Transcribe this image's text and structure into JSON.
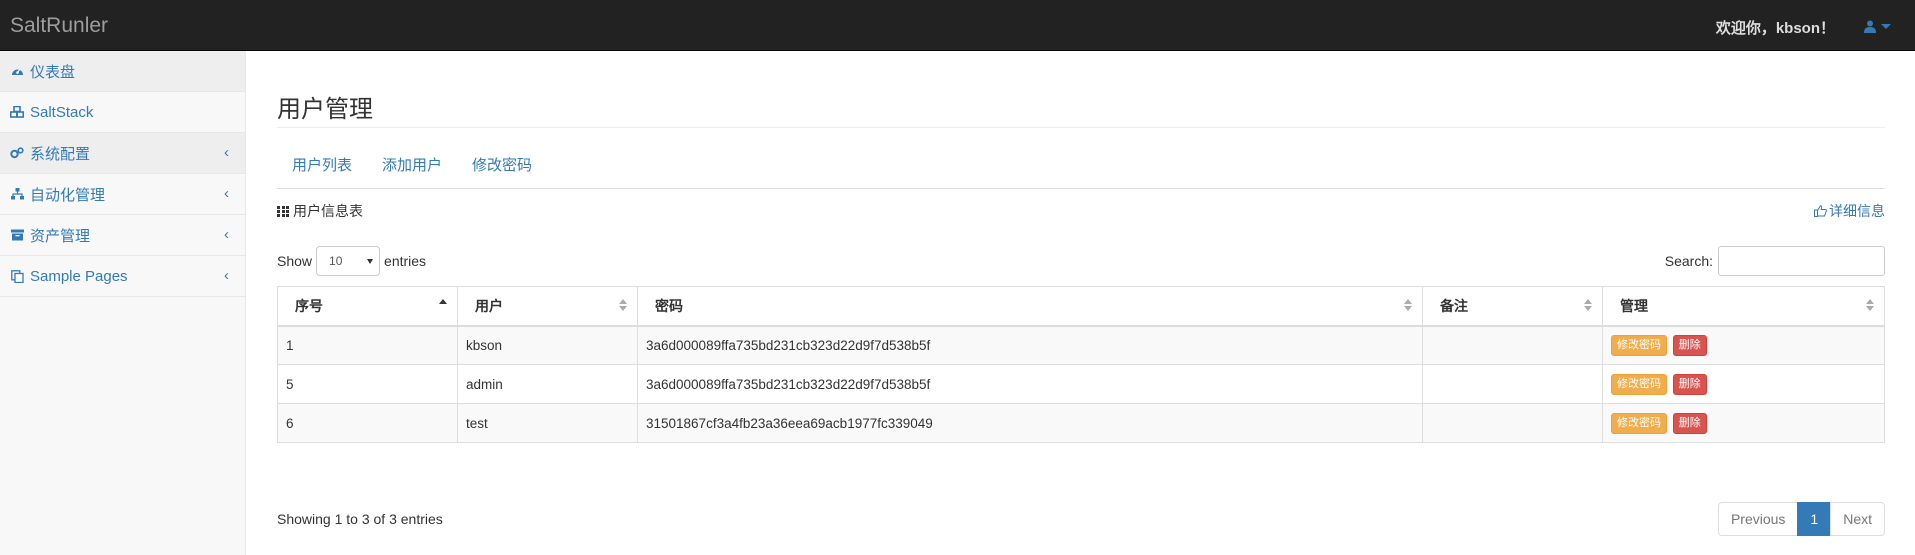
{
  "navbar": {
    "brand": "SaltRunler",
    "welcome": "欢迎你，kbson！"
  },
  "sidebar": {
    "items": [
      {
        "label": "仪表盘",
        "icon": "dashboard-icon"
      },
      {
        "label": "SaltStack",
        "icon": "cubes-icon"
      },
      {
        "label": "系统配置",
        "icon": "gears-icon"
      },
      {
        "label": "自动化管理",
        "icon": "sitemap-icon"
      },
      {
        "label": "资产管理",
        "icon": "archive-icon"
      },
      {
        "label": "Sample Pages",
        "icon": "files-icon"
      }
    ]
  },
  "main": {
    "title": "用户管理",
    "tabs": [
      {
        "label": "用户列表"
      },
      {
        "label": "添加用户"
      },
      {
        "label": "修改密码"
      }
    ],
    "panel_title": "用户信息表",
    "detail_link": "详细信息",
    "length": {
      "show": "Show",
      "value": "10",
      "entries": "entries"
    },
    "search_label": "Search:",
    "table": {
      "headers": [
        "序号",
        "用户",
        "密码",
        "备注",
        "管理"
      ],
      "rows": [
        {
          "id": "1",
          "user": "kbson",
          "password": "3a6d000089ffa735bd231cb323d22d9f7d538b5f",
          "note": ""
        },
        {
          "id": "5",
          "user": "admin",
          "password": "3a6d000089ffa735bd231cb323d22d9f7d538b5f",
          "note": ""
        },
        {
          "id": "6",
          "user": "test",
          "password": "31501867cf3a4fb23a36eea69acb1977fc339049",
          "note": ""
        }
      ],
      "actions": {
        "edit": "修改密码",
        "delete": "删除"
      }
    },
    "info": "Showing 1 to 3 of 3 entries",
    "pagination": {
      "previous": "Previous",
      "current": "1",
      "next": "Next"
    }
  },
  "colors": {
    "navbar": "#222222",
    "link": "#337ab7",
    "warning": "#f0ad4e",
    "danger": "#d9534f"
  }
}
